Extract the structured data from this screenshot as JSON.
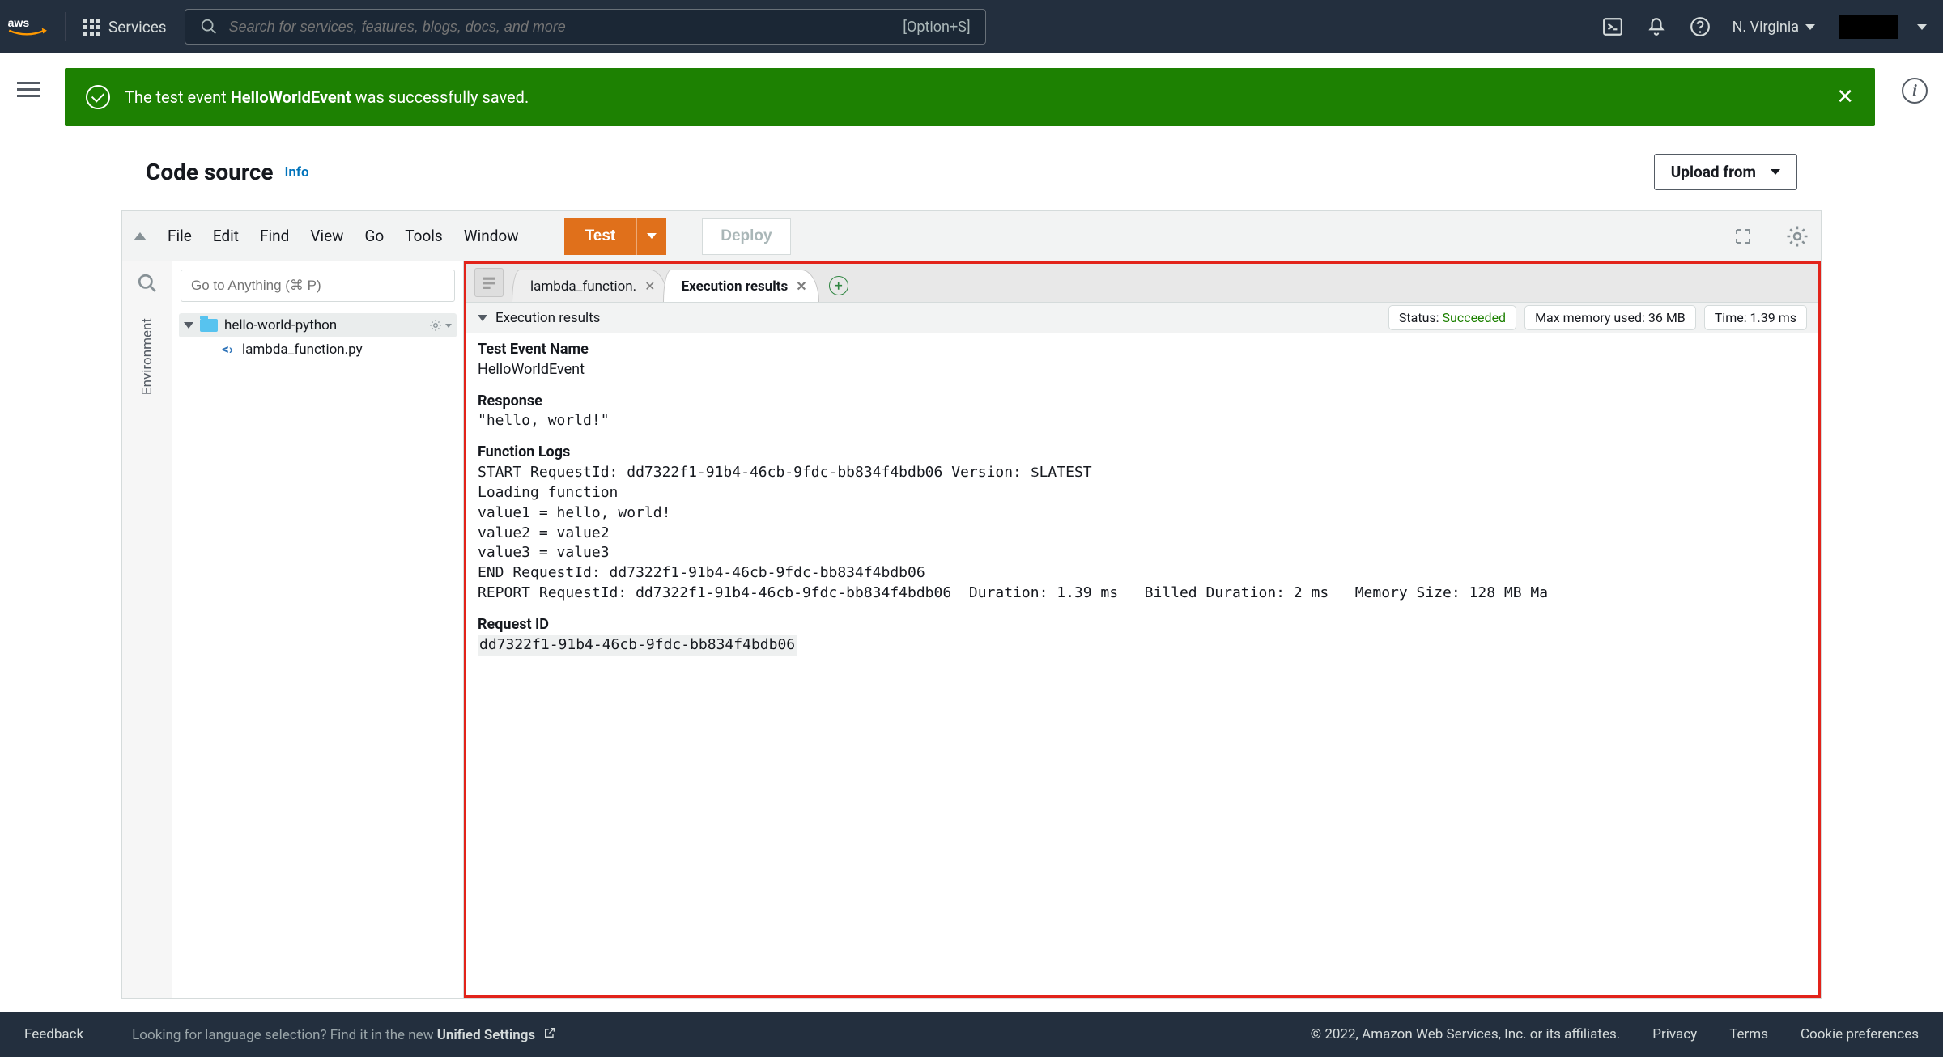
{
  "nav": {
    "services_label": "Services",
    "search_placeholder": "Search for services, features, blogs, docs, and more",
    "search_shortcut": "[Option+S]",
    "region": "N. Virginia"
  },
  "banner": {
    "prefix": "The test event ",
    "event_name": "HelloWorldEvent",
    "suffix": " was successfully saved."
  },
  "section": {
    "title": "Code source",
    "info": "Info",
    "upload_label": "Upload from"
  },
  "ide": {
    "menu": {
      "file": "File",
      "edit": "Edit",
      "find": "Find",
      "view": "View",
      "go": "Go",
      "tools": "Tools",
      "window": "Window"
    },
    "test_label": "Test",
    "deploy_label": "Deploy",
    "goto_placeholder": "Go to Anything (⌘ P)",
    "env_label": "Environment",
    "tree": {
      "project": "hello-world-python",
      "file": "lambda_function.py"
    },
    "tabs": {
      "file_tab": "lambda_function.",
      "result_tab": "Execution results"
    },
    "subhead": "Execution results",
    "badges": {
      "status_k": "Status: ",
      "status_v": "Succeeded",
      "mem_k": "Max memory used: ",
      "mem_v": "36 MB",
      "time_k": "Time: ",
      "time_v": "1.39 ms"
    },
    "results": {
      "event_label": "Test Event Name",
      "event_value": "HelloWorldEvent",
      "response_label": "Response",
      "response_value": "\"hello, world!\"",
      "logs_label": "Function Logs",
      "logs_body": "START RequestId: dd7322f1-91b4-46cb-9fdc-bb834f4bdb06 Version: $LATEST\nLoading function\nvalue1 = hello, world!\nvalue2 = value2\nvalue3 = value3\nEND RequestId: dd7322f1-91b4-46cb-9fdc-bb834f4bdb06\nREPORT RequestId: dd7322f1-91b4-46cb-9fdc-bb834f4bdb06  Duration: 1.39 ms   Billed Duration: 2 ms   Memory Size: 128 MB Ma",
      "reqid_label": "Request ID",
      "reqid_value": "dd7322f1-91b4-46cb-9fdc-bb834f4bdb06"
    }
  },
  "footer": {
    "feedback": "Feedback",
    "lang_prefix": "Looking for language selection? Find it in the new ",
    "lang_link": "Unified Settings",
    "copyright": "© 2022, Amazon Web Services, Inc. or its affiliates.",
    "privacy": "Privacy",
    "terms": "Terms",
    "cookie": "Cookie preferences"
  }
}
